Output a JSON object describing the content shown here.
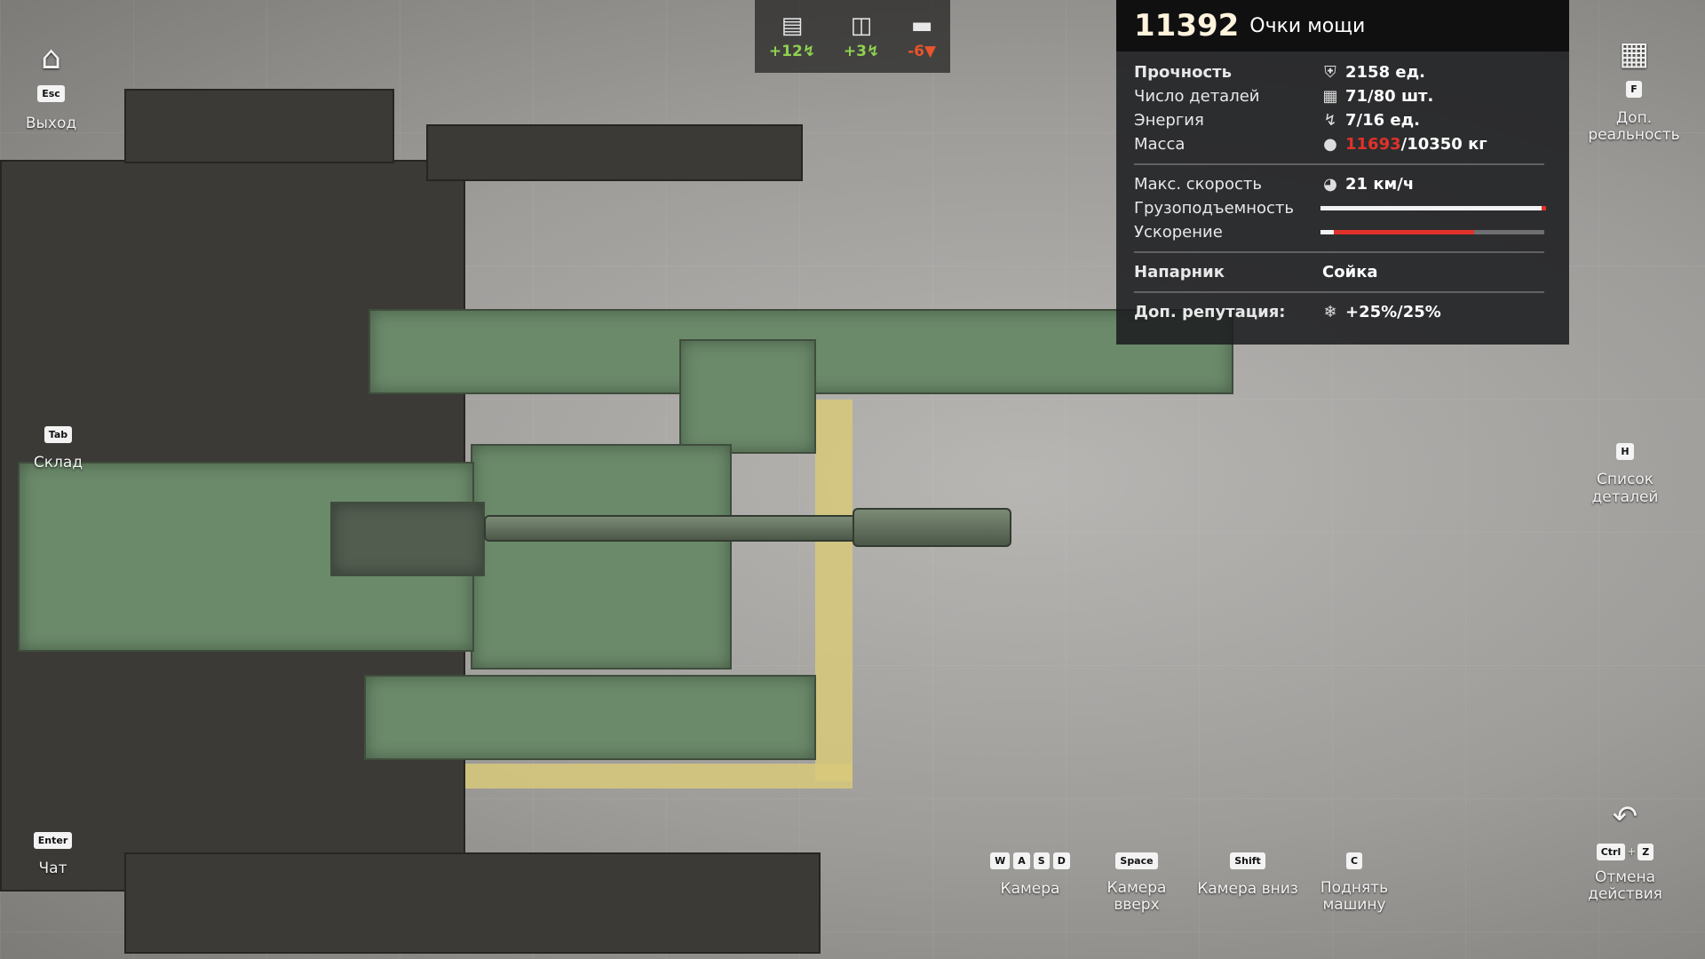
{
  "left_menu": {
    "exit": {
      "key": "Esc",
      "label": "Выход"
    },
    "storage": {
      "key": "Tab",
      "label": "Склад"
    },
    "chat": {
      "key": "Enter",
      "label": "Чат"
    }
  },
  "right_menu": {
    "extra_reality": {
      "key": "F",
      "label_line1": "Доп.",
      "label_line2": "реальность"
    },
    "parts_list": {
      "key": "H",
      "label_line1": "Список",
      "label_line2": "деталей"
    },
    "undo": {
      "key1": "Ctrl",
      "plus": "+",
      "key2": "Z",
      "label_line1": "Отмена",
      "label_line2": "действия"
    }
  },
  "energy_bar": [
    {
      "icon": "vehicle-icon",
      "value": "+12",
      "color": "#8fd14f"
    },
    {
      "icon": "generator-icon",
      "value": "+3",
      "color": "#8fd14f"
    },
    {
      "icon": "weapon-icon",
      "value": "-6",
      "color": "#e8542c"
    }
  ],
  "stats": {
    "power_score": "11392",
    "power_label": "Очки мощи",
    "durability_label": "Прочность",
    "durability_value": "2158 ед.",
    "parts_label": "Число деталей",
    "parts_value": "71/80 шт.",
    "energy_label": "Энергия",
    "energy_value": "7/16 ед.",
    "mass_label": "Масса",
    "mass_current": "11693",
    "mass_rest": "/10350 кг",
    "speed_label": "Макс. скорость",
    "speed_value": "21 км/ч",
    "capacity_label": "Грузоподъемность",
    "capacity_fraction": 0.98,
    "accel_label": "Ускорение",
    "accel_fraction": 0.68,
    "partner_label": "Напарник",
    "partner_value": "Сойка",
    "reputation_label": "Доп. репутация:",
    "reputation_value": "+25%/25%"
  },
  "controls": {
    "camera": {
      "keys": [
        "W",
        "A",
        "S",
        "D"
      ],
      "label": "Камера"
    },
    "camera_up": {
      "key": "Space",
      "label_line1": "Камера",
      "label_line2": "вверх"
    },
    "camera_down": {
      "key": "Shift",
      "label": "Камера вниз"
    },
    "lift": {
      "key": "C",
      "label_line1": "Поднять",
      "label_line2": "машину"
    }
  },
  "colors": {
    "positive": "#8fd14f",
    "negative": "#e8542c",
    "warning": "#e0322a"
  }
}
